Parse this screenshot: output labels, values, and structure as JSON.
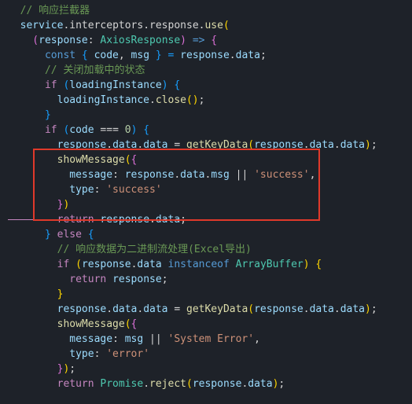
{
  "code": {
    "l1": "  // 响应拦截器",
    "l2_a": "  service",
    "l2_b": ".interceptors.response.",
    "l2_c": "use",
    "l3_a": "    (",
    "l3_b": "response",
    "l3_c": ": ",
    "l3_d": "AxiosResponse",
    "l3_e": ") ",
    "l3_f": "=>",
    "l3_g": " {",
    "l4_a": "      const",
    "l4_b": " { ",
    "l4_c": "code",
    "l4_d": ", ",
    "l4_e": "msg",
    "l4_f": " } = ",
    "l4_g": "response",
    "l4_h": ".",
    "l4_i": "data",
    "l4_j": ";",
    "l5": "      // 关闭加载中的状态",
    "l6_a": "      if",
    "l6_b": " (",
    "l6_c": "loadingInstance",
    "l6_d": ") {",
    "l7_a": "        loadingInstance",
    "l7_b": ".",
    "l7_c": "close",
    "l7_d": "();",
    "l8": "      }",
    "l9": "",
    "l10_a": "      if",
    "l10_b": " (",
    "l10_c": "code",
    "l10_d": " === ",
    "l10_e": "0",
    "l10_f": ") {",
    "l11_a": "        response",
    "l11_b": ".",
    "l11_c": "data",
    "l11_d": ".",
    "l11_e": "data",
    "l11_f": " = ",
    "l11_g": "getKeyData",
    "l11_h": "(",
    "l11_i": "response",
    "l11_j": ".",
    "l11_k": "data",
    "l11_l": ".",
    "l11_m": "data",
    "l11_n": ");",
    "l12_a": "        showMessage",
    "l12_b": "({",
    "l13_a": "          message",
    "l13_b": ": ",
    "l13_c": "response",
    "l13_d": ".",
    "l13_e": "data",
    "l13_f": ".",
    "l13_g": "msg",
    "l13_h": " || ",
    "l13_i": "'success'",
    "l13_j": ",",
    "l14_a": "          type",
    "l14_b": ": ",
    "l14_c": "'success'",
    "l15": "        })",
    "l16_a": "        return",
    "l16_b": " ",
    "l16_c": "response",
    "l16_d": ".",
    "l16_e": "data",
    "l16_f": ";",
    "l17_a": "      } ",
    "l17_b": "else",
    "l17_c": " {",
    "l18": "        // 响应数据为二进制流处理(Excel导出)",
    "l19_a": "        if",
    "l19_b": " (",
    "l19_c": "response",
    "l19_d": ".",
    "l19_e": "data",
    "l19_f": " ",
    "l19_g": "instanceof",
    "l19_h": " ",
    "l19_i": "ArrayBuffer",
    "l19_j": ") {",
    "l20_a": "          return",
    "l20_b": " ",
    "l20_c": "response",
    "l20_d": ";",
    "l21": "        }",
    "l22_a": "        response",
    "l22_b": ".",
    "l22_c": "data",
    "l22_d": ".",
    "l22_e": "data",
    "l22_f": " = ",
    "l22_g": "getKeyData",
    "l22_h": "(",
    "l22_i": "response",
    "l22_j": ".",
    "l22_k": "data",
    "l22_l": ".",
    "l22_m": "data",
    "l22_n": ");",
    "l23_a": "        showMessage",
    "l23_b": "({",
    "l24_a": "          message",
    "l24_b": ": ",
    "l24_c": "msg",
    "l24_d": " || ",
    "l24_e": "'System Error'",
    "l24_f": ",",
    "l25_a": "          type",
    "l25_b": ": ",
    "l25_c": "'error'",
    "l26": "        });",
    "l27_a": "        return",
    "l27_b": " ",
    "l27_c": "Promise",
    "l27_d": ".",
    "l27_e": "reject",
    "l27_f": "(",
    "l27_g": "response",
    "l27_h": ".",
    "l27_i": "data",
    "l27_j": ");"
  }
}
